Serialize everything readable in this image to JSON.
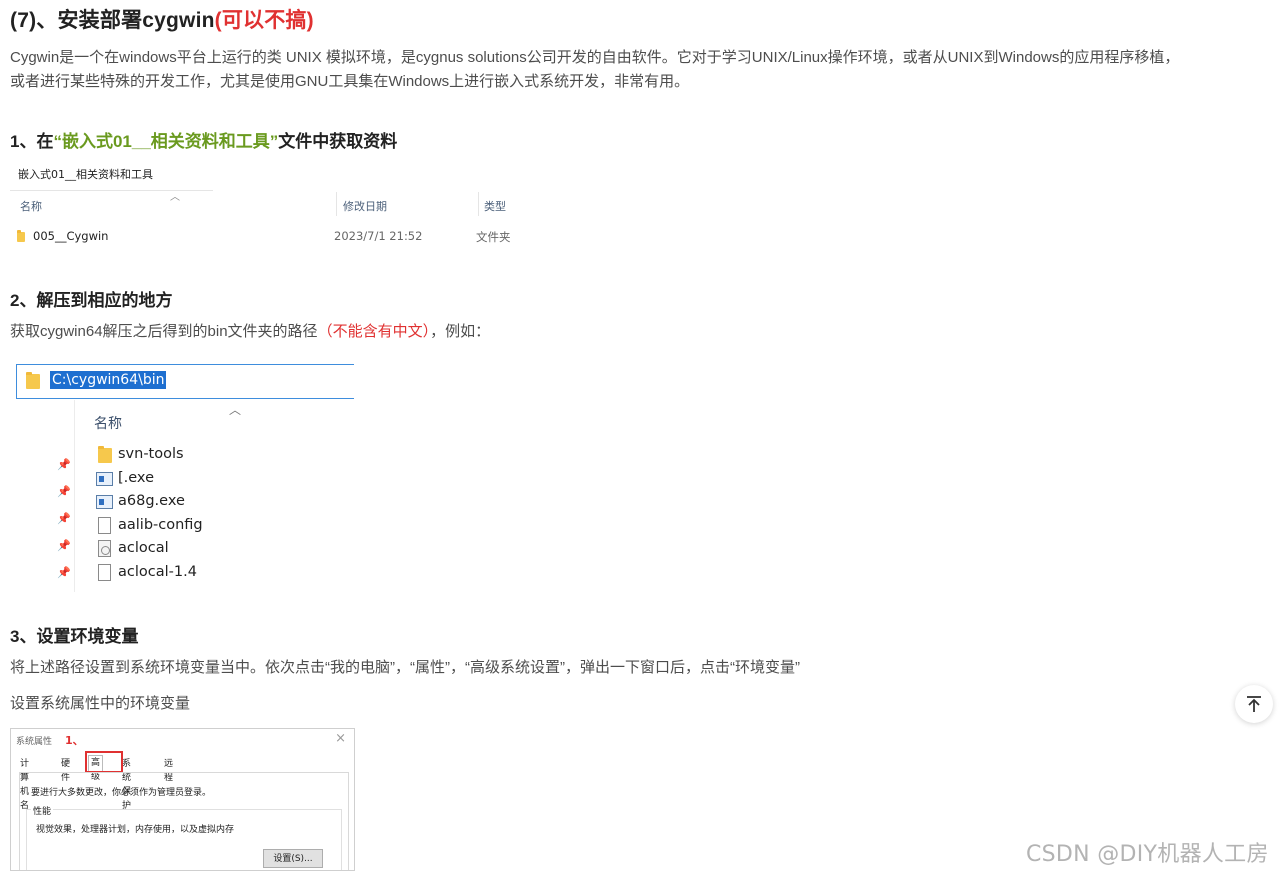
{
  "heading": {
    "prefix": "(7)、安装部署cygwin",
    "note": "(可以不搞)"
  },
  "intro": {
    "line1": "Cygwin是一个在windows平台上运行的类 UNIX 模拟环境，是cygnus solutions公司开发的自由软件。它对于学习UNIX/Linux操作环境，或者从UNIX到Windows的应用程序移植，",
    "line2": "或者进行某些特殊的开发工作，尤其是使用GNU工具集在Windows上进行嵌入式系统开发，非常有用。"
  },
  "step1": {
    "prefix": "1、在",
    "highlight": "“嵌入式01__相关资料和工具”",
    "suffix": "文件中获取资料",
    "explorer": {
      "breadcrumb": "嵌入式01__相关资料和工具",
      "col_name": "名称",
      "col_date": "修改日期",
      "col_type": "类型",
      "rows": [
        {
          "name": "005__Cygwin",
          "date": "2023/7/1 21:52",
          "type": "文件夹"
        }
      ]
    }
  },
  "step2": {
    "title": "2、解压到相应的地方",
    "text_prefix": "获取cygwin64解压之后得到的bin文件夹的路径",
    "text_red": "（不能含有中文）",
    "text_suffix": "，例如：",
    "explorer": {
      "address": "C:\\cygwin64\\bin",
      "col_name": "名称",
      "items": [
        "svn-tools",
        "[.exe",
        "a68g.exe",
        "aalib-config",
        "aclocal",
        "aclocal-1.4"
      ]
    }
  },
  "step3": {
    "title": "3、设置环境变量",
    "text": "将上述路径设置到系统环境变量当中。依次点击“我的电脑”，“属性”，“高级系统设置”，弹出一下窗口后，点击“环境变量”",
    "subtext": "设置系统属性中的环境变量",
    "dialog": {
      "title": "系统属性",
      "step_label": "1、",
      "close": "×",
      "tabs": [
        "计算机名",
        "硬件",
        "高级",
        "系统保护",
        "远程"
      ],
      "note": "要进行大多数更改，你必须作为管理员登录。",
      "group_label": "性能",
      "group_desc": "视觉效果，处理器计划，内存使用，以及虚拟内存",
      "settings_button": "设置(S)..."
    }
  },
  "watermark": "CSDN @DIY机器人工房"
}
